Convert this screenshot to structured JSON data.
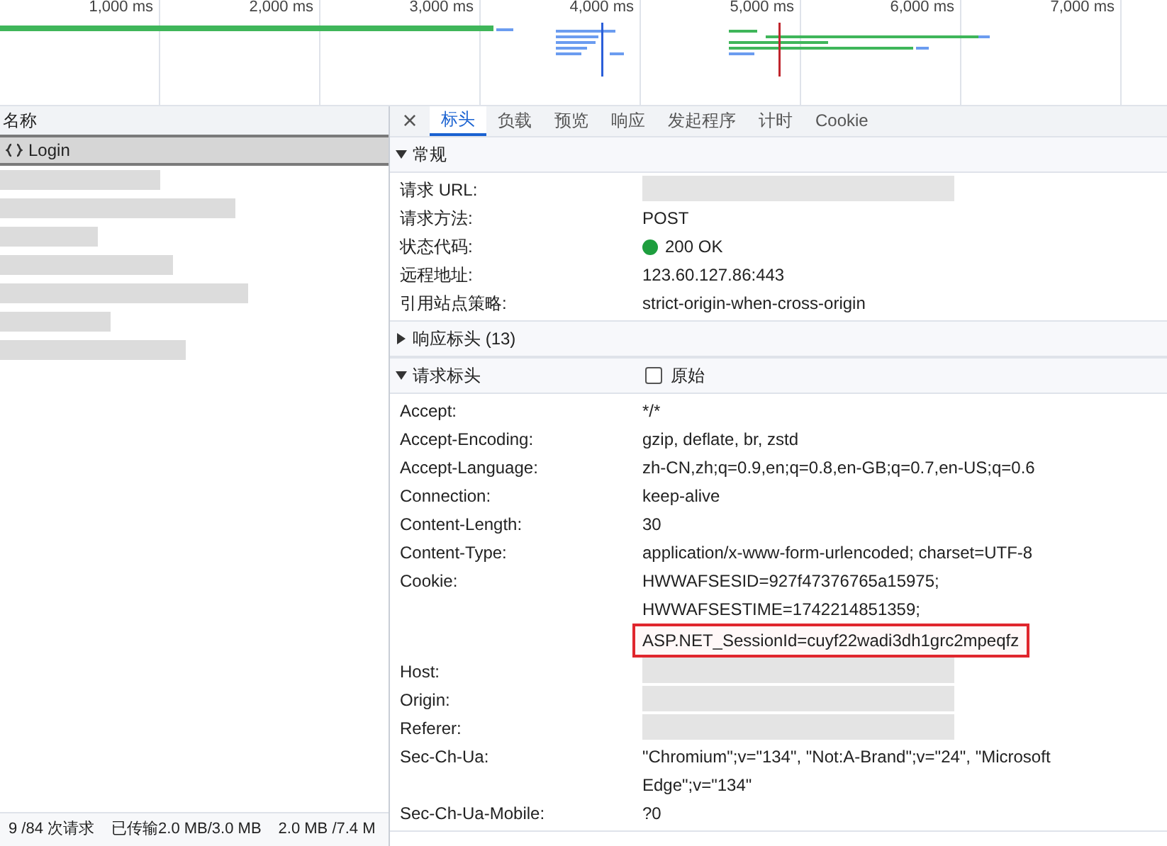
{
  "timeline": {
    "ticks": [
      "1,000 ms",
      "2,000 ms",
      "3,000 ms",
      "4,000 ms",
      "5,000 ms",
      "6,000 ms",
      "7,000 ms"
    ]
  },
  "request_list": {
    "column": "名称",
    "items": [
      {
        "kind": "named",
        "name": "Login",
        "selected": true
      },
      {
        "kind": "redacted",
        "selected": false
      },
      {
        "kind": "redacted",
        "selected": false
      },
      {
        "kind": "redacted",
        "selected": false
      },
      {
        "kind": "redacted",
        "selected": false
      },
      {
        "kind": "redacted",
        "selected": false
      },
      {
        "kind": "redacted",
        "selected": false
      },
      {
        "kind": "redacted",
        "selected": false
      }
    ]
  },
  "status_bar": [
    "9 /84 次请求",
    "已传输2.0 MB/3.0 MB",
    "2.0 MB /7.4 M"
  ],
  "close_label": "×",
  "tabs": [
    {
      "label": "标头",
      "selected": true
    },
    {
      "label": "负载",
      "selected": false
    },
    {
      "label": "预览",
      "selected": false
    },
    {
      "label": "响应",
      "selected": false
    },
    {
      "label": "发起程序",
      "selected": false
    },
    {
      "label": "计时",
      "selected": false
    },
    {
      "label": "Cookie",
      "selected": false
    }
  ],
  "sections": [
    {
      "title": "常规",
      "expanded": true,
      "rows": [
        {
          "name": "请求 URL:",
          "kind": "redacted"
        },
        {
          "name": "请求方法:",
          "kind": "text",
          "value": "POST"
        },
        {
          "name": "状态代码:",
          "kind": "status",
          "color": "#1e9e3e",
          "value": "200 OK"
        },
        {
          "name": "远程地址:",
          "kind": "text",
          "value": "123.60.127.86:443"
        },
        {
          "name": "引用站点策略:",
          "kind": "text",
          "value": "strict-origin-when-cross-origin"
        }
      ]
    },
    {
      "title": "响应标头 (13)",
      "expanded": false
    },
    {
      "title": "请求标头",
      "expanded": true,
      "raw": {
        "label": "原始",
        "checked": false
      },
      "rows": [
        {
          "name": "Accept:",
          "kind": "text",
          "value": "*/*"
        },
        {
          "name": "Accept-Encoding:",
          "kind": "text",
          "value": "gzip, deflate, br, zstd"
        },
        {
          "name": "Accept-Language:",
          "kind": "text",
          "value": "zh-CN,zh;q=0.9,en;q=0.8,en-GB;q=0.7,en-US;q=0.6"
        },
        {
          "name": "Connection:",
          "kind": "text",
          "value": "keep-alive"
        },
        {
          "name": "Content-Length:",
          "kind": "text",
          "value": "30"
        },
        {
          "name": "Content-Type:",
          "kind": "text",
          "value": "application/x-www-form-urlencoded; charset=UTF-8"
        },
        {
          "name": "Cookie:",
          "kind": "lines",
          "lines": [
            {
              "text": "HWWAFSESID=927f47376765a15975;",
              "highlighted": false
            },
            {
              "text": "HWWAFSESTIME=1742214851359;",
              "highlighted": false
            },
            {
              "text": "ASP.NET_SessionId=cuyf22wadi3dh1grc2mpeqfz",
              "highlighted": true
            }
          ]
        },
        {
          "name": "Host:",
          "kind": "redacted"
        },
        {
          "name": "Origin:",
          "kind": "redacted"
        },
        {
          "name": "Referer:",
          "kind": "redacted"
        },
        {
          "name": "Sec-Ch-Ua:",
          "kind": "text",
          "value": "\"Chromium\";v=\"134\", \"Not:A-Brand\";v=\"24\", \"Microsoft Edge\";v=\"134\""
        },
        {
          "name": "Sec-Ch-Ua-Mobile:",
          "kind": "text",
          "value": "?0"
        }
      ]
    }
  ]
}
